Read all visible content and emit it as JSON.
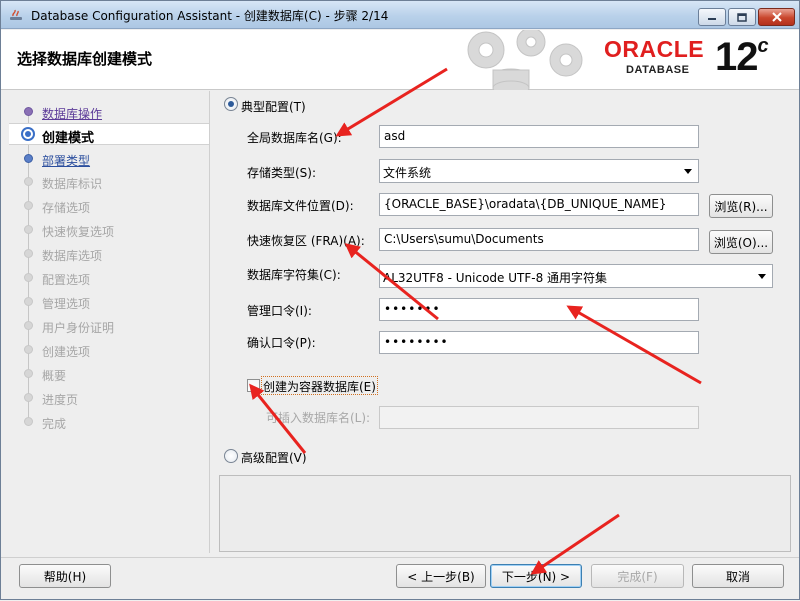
{
  "window": {
    "title": "Database Configuration Assistant - 创建数据库(C) - 步骤 2/14"
  },
  "header": {
    "page_title": "选择数据库创建模式",
    "brand": "ORACLE",
    "product": "DATABASE",
    "version": "12",
    "version_suffix": "c"
  },
  "nav": {
    "items": [
      {
        "label": "数据库操作",
        "state": "visited"
      },
      {
        "label": "创建模式",
        "state": "current"
      },
      {
        "label": "部署类型",
        "state": "link"
      },
      {
        "label": "数据库标识",
        "state": "disabled"
      },
      {
        "label": "存储选项",
        "state": "disabled"
      },
      {
        "label": "快速恢复选项",
        "state": "disabled"
      },
      {
        "label": "数据库选项",
        "state": "disabled"
      },
      {
        "label": "配置选项",
        "state": "disabled"
      },
      {
        "label": "管理选项",
        "state": "disabled"
      },
      {
        "label": "用户身份证明",
        "state": "disabled"
      },
      {
        "label": "创建选项",
        "state": "disabled"
      },
      {
        "label": "概要",
        "state": "disabled"
      },
      {
        "label": "进度页",
        "state": "disabled"
      },
      {
        "label": "完成",
        "state": "disabled"
      }
    ]
  },
  "form": {
    "typical_label": "典型配置(T)",
    "typical_selected": true,
    "global_db_name_label": "全局数据库名(G):",
    "global_db_name_value": "asd",
    "storage_type_label": "存储类型(S):",
    "storage_type_value": "文件系统",
    "db_file_location_label": "数据库文件位置(D):",
    "db_file_location_value": "{ORACLE_BASE}\\oradata\\{DB_UNIQUE_NAME}",
    "browse_r_label": "浏览(R)...",
    "fra_label": "快速恢复区 (FRA)(A):",
    "fra_value": "C:\\Users\\sumu\\Documents",
    "browse_o_label": "浏览(O)...",
    "charset_label": "数据库字符集(C):",
    "charset_value": "AL32UTF8 - Unicode UTF-8 通用字符集",
    "admin_pwd_label": "管理口令(I):",
    "admin_pwd_value": "•••••••",
    "confirm_pwd_label": "确认口令(P):",
    "confirm_pwd_value": "••••••••",
    "container_db_label": "创建为容器数据库(E)",
    "container_db_checked": false,
    "pdb_name_label": "可插入数据库名(L):",
    "pdb_name_value": "",
    "advanced_label": "高级配置(V)",
    "advanced_selected": false
  },
  "footer": {
    "help_label": "帮助(H)",
    "back_label": "< 上一步(B)",
    "next_label": "下一步(N) >",
    "finish_label": "完成(F)",
    "cancel_label": "取消"
  },
  "colors": {
    "oracle_red": "#e01f1f",
    "annotation_red": "#e8231f",
    "nav_current_ring": "#3a6fc7"
  }
}
